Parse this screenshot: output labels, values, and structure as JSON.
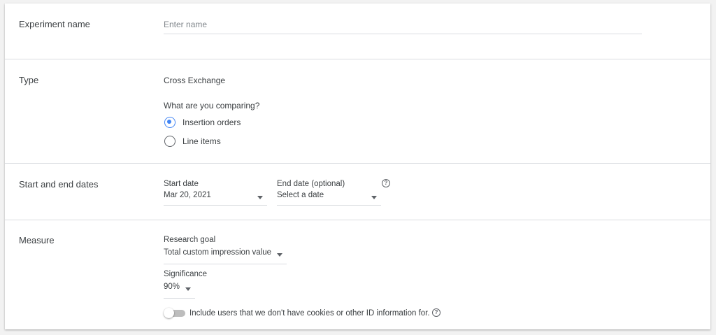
{
  "sections": {
    "experiment_name": {
      "label": "Experiment name",
      "input_placeholder": "Enter name",
      "input_value": ""
    },
    "type": {
      "label": "Type",
      "value": "Cross Exchange",
      "question": "What are you comparing?",
      "options": [
        {
          "label": "Insertion orders",
          "selected": true
        },
        {
          "label": "Line items",
          "selected": false
        }
      ]
    },
    "dates": {
      "label": "Start and end dates",
      "start_label": "Start date",
      "start_value": "Mar 20, 2021",
      "end_label": "End date (optional)",
      "end_value": "Select a date",
      "help_icon": "help-circle-icon"
    },
    "measure": {
      "label": "Measure",
      "goal_label": "Research goal",
      "goal_value": "Total custom impression value",
      "significance_label": "Significance",
      "significance_value": "90%",
      "toggle_label": "Include users that we don't have cookies or other ID information for.",
      "toggle_on": false,
      "help_icon": "help-circle-icon"
    }
  },
  "colors": {
    "accent": "#4285f4",
    "divider": "#dadce0",
    "text": "#3c4043",
    "placeholder": "#80868b",
    "background": "#f2f2f2"
  }
}
